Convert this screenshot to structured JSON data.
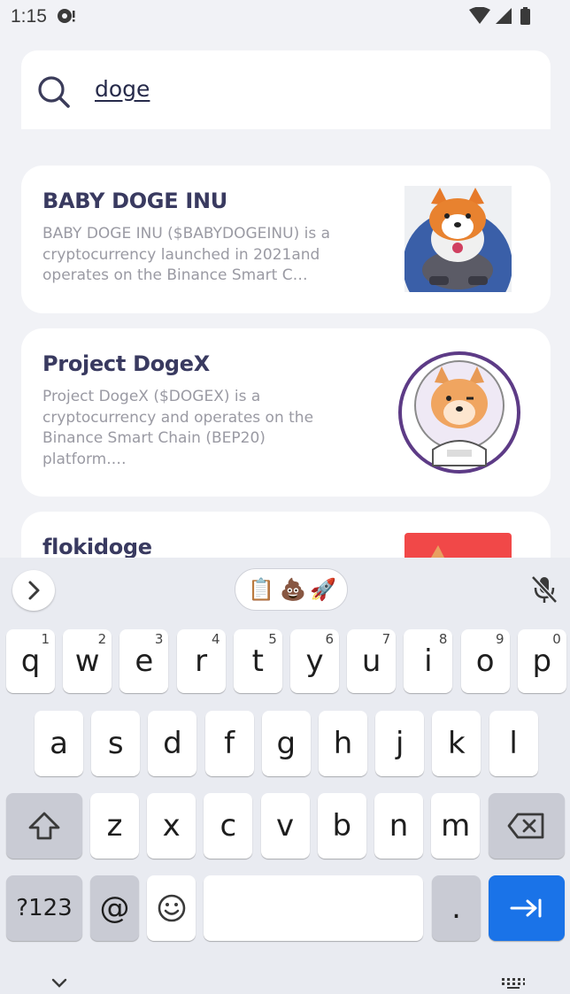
{
  "status_bar": {
    "time": "1:15"
  },
  "search": {
    "query": "doge"
  },
  "results": [
    {
      "title": "BABY DOGE INU",
      "description": "BABY DOGE INU ($BABYDOGEINU) is a cryptocurrency launched in 2021and operates on the Binance Smart C…"
    },
    {
      "title": "Project DogeX",
      "description": "Project DogeX ($DOGEX) is a cryptocurrency and operates on the Binance Smart Chain (BEP20) platform.…"
    },
    {
      "title": "flokidoge",
      "description": ""
    }
  ],
  "keyboard": {
    "row1": [
      {
        "k": "q",
        "h": "1"
      },
      {
        "k": "w",
        "h": "2"
      },
      {
        "k": "e",
        "h": "3"
      },
      {
        "k": "r",
        "h": "4"
      },
      {
        "k": "t",
        "h": "5"
      },
      {
        "k": "y",
        "h": "6"
      },
      {
        "k": "u",
        "h": "7"
      },
      {
        "k": "i",
        "h": "8"
      },
      {
        "k": "o",
        "h": "9"
      },
      {
        "k": "p",
        "h": "0"
      }
    ],
    "row2": [
      "a",
      "s",
      "d",
      "f",
      "g",
      "h",
      "j",
      "k",
      "l"
    ],
    "row3": [
      "z",
      "x",
      "c",
      "v",
      "b",
      "n",
      "m"
    ],
    "symbols_label": "?123",
    "at_label": "@",
    "period_label": ".",
    "suggestion_emojis": [
      "📋",
      "💩",
      "🚀"
    ]
  },
  "colors": {
    "background": "#f1f2f6",
    "card": "#ffffff",
    "title": "#393a60",
    "description": "#9a9aa3",
    "keyboard_bg": "#e9ebf1",
    "enter_key": "#1a73e8"
  }
}
